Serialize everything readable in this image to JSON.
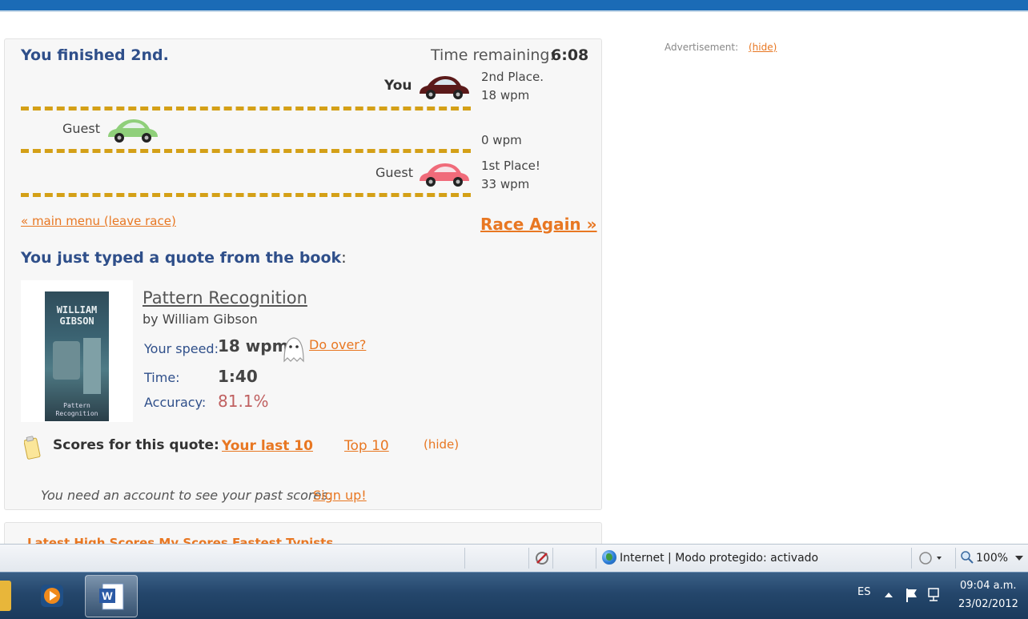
{
  "race": {
    "result_title": "You finished 2nd.",
    "time_label": "Time remaining:",
    "time_value": "6:08",
    "racers": [
      {
        "name": "You",
        "place": "2nd Place.",
        "wpm": "18 wpm",
        "car_color": "#5b1a1a"
      },
      {
        "name": "Guest",
        "place": "",
        "wpm": "0 wpm",
        "car_color": "#8fcf7a"
      },
      {
        "name": "Guest",
        "place": "1st Place!",
        "wpm": "33 wpm",
        "car_color": "#f06b7a"
      }
    ],
    "main_menu_link": "« main menu (leave race)",
    "race_again_link": "Race Again »"
  },
  "quote": {
    "heading_bold": "You just typed a quote from the book",
    "heading_colon": ":",
    "book_title": "Pattern Recognition",
    "book_author": "by William Gibson",
    "cover_top": "WILLIAM GIBSON",
    "cover_bottom": "Pattern Recognition",
    "speed_label": "Your speed:",
    "speed_value": "18 wpm",
    "do_over": "Do over?",
    "time_label": "Time:",
    "time_value": "1:40",
    "accuracy_label": "Accuracy:",
    "accuracy_value": "81.1%"
  },
  "scores": {
    "label": "Scores for this quote:",
    "tab_last": "Your last 10",
    "tab_top": "Top 10",
    "hide": "(hide)",
    "need_account": "You need an account to see your past scores.",
    "signup": "Sign up!"
  },
  "next_panel_cut": "Latest High Scores  My Scores  Fastest Typists",
  "ad": {
    "label": "Advertisement:",
    "hide": "(hide)"
  },
  "statusbar": {
    "zone": "Internet | Modo protegido: activado",
    "zoom": "100%"
  },
  "taskbar": {
    "lang": "ES",
    "time": "09:04 a.m.",
    "date": "23/02/2012"
  },
  "colors": {
    "accent_orange": "#e87722",
    "heading_blue": "#2f4f8a",
    "lane_gold": "#d4a017"
  }
}
